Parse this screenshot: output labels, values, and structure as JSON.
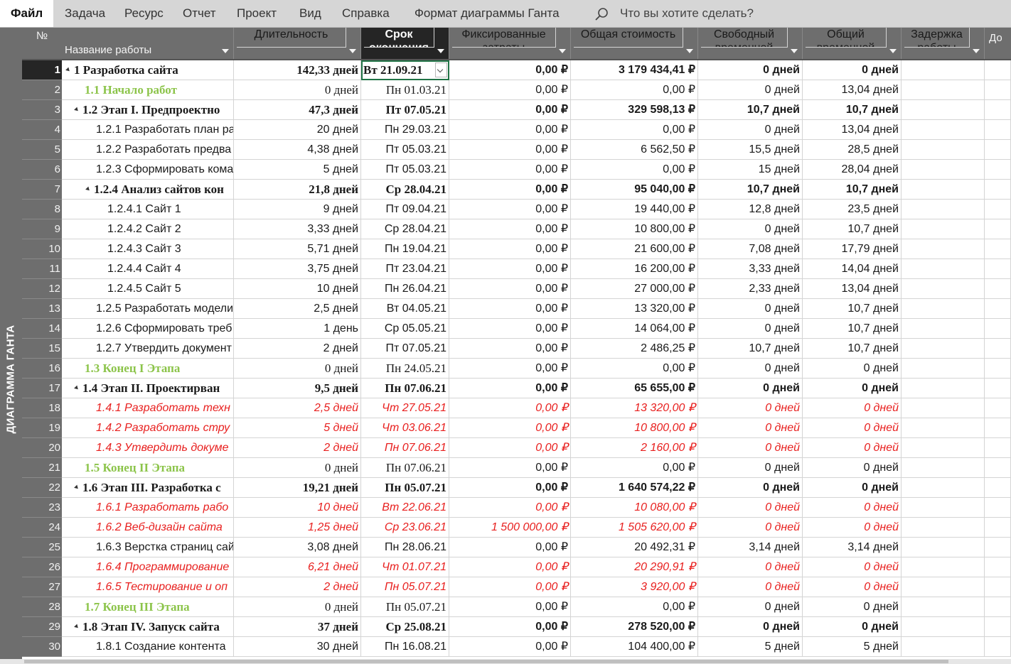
{
  "menu": {
    "file": "Файл",
    "items": [
      "Задача",
      "Ресурс",
      "Отчет",
      "Проект",
      "Вид",
      "Справка",
      "Формат диаграммы Ганта"
    ],
    "search_placeholder": "Что вы хотите сделать?"
  },
  "sidebar_label": "ДИАГРАММА ГАНТА",
  "columns": {
    "num": "№",
    "name": "Название работы",
    "duration": "Длительность",
    "finish": [
      "Срок",
      "окончания"
    ],
    "fixed_cost": [
      "Фиксированные",
      "затраты"
    ],
    "total_cost": "Общая стоимость",
    "free_slack": [
      "Свободный",
      "временной"
    ],
    "total_slack": [
      "Общий",
      "временной"
    ],
    "delay": [
      "Задержка",
      "работы"
    ],
    "next": "До"
  },
  "rows": [
    {
      "n": "1",
      "name": "1 Разработка сайта",
      "dur": "142,33 дней",
      "fin": "Вт 21.09.21",
      "fix": "0,00 ₽",
      "cost": "3 179 434,41 ₽",
      "free": "0 дней",
      "total": "0 дней",
      "type": "summary",
      "level": 0
    },
    {
      "n": "2",
      "name": "1.1 Начало работ",
      "dur": "0 дней",
      "fin": "Пн 01.03.21",
      "fix": "0,00 ₽",
      "cost": "0,00 ₽",
      "free": "0 дней",
      "total": "13,04 дней",
      "type": "milestone",
      "level": 1
    },
    {
      "n": "3",
      "name": "1.2 Этап I. Предпроектно",
      "dur": "47,3 дней",
      "fin": "Пт 07.05.21",
      "fix": "0,00 ₽",
      "cost": "329 598,13 ₽",
      "free": "10,7 дней",
      "total": "10,7 дней",
      "type": "summary",
      "level": 1
    },
    {
      "n": "4",
      "name": "1.2.1 Разработать план ра",
      "dur": "20 дней",
      "fin": "Пн 29.03.21",
      "fix": "0,00 ₽",
      "cost": "0,00 ₽",
      "free": "0 дней",
      "total": "13,04 дней",
      "type": "normal",
      "level": 2
    },
    {
      "n": "5",
      "name": "1.2.2 Разработать предва",
      "dur": "4,38 дней",
      "fin": "Пт 05.03.21",
      "fix": "0,00 ₽",
      "cost": "6 562,50 ₽",
      "free": "15,5 дней",
      "total": "28,5 дней",
      "type": "normal",
      "level": 2
    },
    {
      "n": "6",
      "name": "1.2.3 Сформировать кома",
      "dur": "5 дней",
      "fin": "Пт 05.03.21",
      "fix": "0,00 ₽",
      "cost": "0,00 ₽",
      "free": "15 дней",
      "total": "28,04 дней",
      "type": "normal",
      "level": 2
    },
    {
      "n": "7",
      "name": "1.2.4 Анализ сайтов кон",
      "dur": "21,8 дней",
      "fin": "Ср 28.04.21",
      "fix": "0,00 ₽",
      "cost": "95 040,00 ₽",
      "free": "10,7 дней",
      "total": "10,7 дней",
      "type": "summary2",
      "level": 2
    },
    {
      "n": "8",
      "name": "1.2.4.1 Сайт 1",
      "dur": "9 дней",
      "fin": "Пт 09.04.21",
      "fix": "0,00 ₽",
      "cost": "19 440,00 ₽",
      "free": "12,8 дней",
      "total": "23,5 дней",
      "type": "normal",
      "level": 3
    },
    {
      "n": "9",
      "name": "1.2.4.2 Сайт 2",
      "dur": "3,33 дней",
      "fin": "Ср 28.04.21",
      "fix": "0,00 ₽",
      "cost": "10 800,00 ₽",
      "free": "0 дней",
      "total": "10,7 дней",
      "type": "normal",
      "level": 3
    },
    {
      "n": "10",
      "name": "1.2.4.3 Сайт 3",
      "dur": "5,71 дней",
      "fin": "Пн 19.04.21",
      "fix": "0,00 ₽",
      "cost": "21 600,00 ₽",
      "free": "7,08 дней",
      "total": "17,79 дней",
      "type": "normal",
      "level": 3
    },
    {
      "n": "11",
      "name": "1.2.4.4 Сайт 4",
      "dur": "3,75 дней",
      "fin": "Пт 23.04.21",
      "fix": "0,00 ₽",
      "cost": "16 200,00 ₽",
      "free": "3,33 дней",
      "total": "14,04 дней",
      "type": "normal",
      "level": 3
    },
    {
      "n": "12",
      "name": "1.2.4.5 Сайт 5",
      "dur": "10 дней",
      "fin": "Пн 26.04.21",
      "fix": "0,00 ₽",
      "cost": "27 000,00 ₽",
      "free": "2,33 дней",
      "total": "13,04 дней",
      "type": "normal",
      "level": 3
    },
    {
      "n": "13",
      "name": "1.2.5 Разработать модели",
      "dur": "2,5 дней",
      "fin": "Вт 04.05.21",
      "fix": "0,00 ₽",
      "cost": "13 320,00 ₽",
      "free": "0 дней",
      "total": "10,7 дней",
      "type": "normal",
      "level": 2
    },
    {
      "n": "14",
      "name": "1.2.6 Сформировать треб",
      "dur": "1 день",
      "fin": "Ср 05.05.21",
      "fix": "0,00 ₽",
      "cost": "14 064,00 ₽",
      "free": "0 дней",
      "total": "10,7 дней",
      "type": "normal",
      "level": 2
    },
    {
      "n": "15",
      "name": "1.2.7 Утвердить документ",
      "dur": "2 дней",
      "fin": "Пт 07.05.21",
      "fix": "0,00 ₽",
      "cost": "2 486,25 ₽",
      "free": "10,7 дней",
      "total": "10,7 дней",
      "type": "normal",
      "level": 2
    },
    {
      "n": "16",
      "name": "1.3 Конец I Этапа",
      "dur": "0 дней",
      "fin": "Пн 24.05.21",
      "fix": "0,00 ₽",
      "cost": "0,00 ₽",
      "free": "0 дней",
      "total": "0 дней",
      "type": "milestone",
      "level": 1
    },
    {
      "n": "17",
      "name": "1.4 Этап II. Проектирван",
      "dur": "9,5 дней",
      "fin": "Пн 07.06.21",
      "fix": "0,00 ₽",
      "cost": "65 655,00 ₽",
      "free": "0 дней",
      "total": "0 дней",
      "type": "summary",
      "level": 1
    },
    {
      "n": "18",
      "name": "1.4.1 Разработать техн",
      "dur": "2,5 дней",
      "fin": "Чт 27.05.21",
      "fix": "0,00 ₽",
      "cost": "13 320,00 ₽",
      "free": "0 дней",
      "total": "0 дней",
      "type": "critical",
      "level": 2
    },
    {
      "n": "19",
      "name": "1.4.2 Разработать стру",
      "dur": "5 дней",
      "fin": "Чт 03.06.21",
      "fix": "0,00 ₽",
      "cost": "10 800,00 ₽",
      "free": "0 дней",
      "total": "0 дней",
      "type": "critical",
      "level": 2
    },
    {
      "n": "20",
      "name": "1.4.3 Утвердить докуме",
      "dur": "2 дней",
      "fin": "Пн 07.06.21",
      "fix": "0,00 ₽",
      "cost": "2 160,00 ₽",
      "free": "0 дней",
      "total": "0 дней",
      "type": "critical",
      "level": 2
    },
    {
      "n": "21",
      "name": "1.5 Конец II Этапа",
      "dur": "0 дней",
      "fin": "Пн 07.06.21",
      "fix": "0,00 ₽",
      "cost": "0,00 ₽",
      "free": "0 дней",
      "total": "0 дней",
      "type": "milestone",
      "level": 1
    },
    {
      "n": "22",
      "name": "1.6 Этап III. Разработка с",
      "dur": "19,21 дней",
      "fin": "Пн 05.07.21",
      "fix": "0,00 ₽",
      "cost": "1 640 574,22 ₽",
      "free": "0 дней",
      "total": "0 дней",
      "type": "summary",
      "level": 1
    },
    {
      "n": "23",
      "name": "1.6.1 Разработать рабо",
      "dur": "10 дней",
      "fin": "Вт 22.06.21",
      "fix": "0,00 ₽",
      "cost": "10 080,00 ₽",
      "free": "0 дней",
      "total": "0 дней",
      "type": "critical",
      "level": 2
    },
    {
      "n": "24",
      "name": "1.6.2 Веб-дизайн сайта",
      "dur": "1,25 дней",
      "fin": "Ср 23.06.21",
      "fix": "1 500 000,00 ₽",
      "cost": "1 505 620,00 ₽",
      "free": "0 дней",
      "total": "0 дней",
      "type": "critical",
      "level": 2
    },
    {
      "n": "25",
      "name": "1.6.3 Верстка страниц сай",
      "dur": "3,08 дней",
      "fin": "Пн 28.06.21",
      "fix": "0,00 ₽",
      "cost": "20 492,31 ₽",
      "free": "3,14 дней",
      "total": "3,14 дней",
      "type": "normal",
      "level": 2
    },
    {
      "n": "26",
      "name": "1.6.4 Программирование",
      "dur": "6,21 дней",
      "fin": "Чт 01.07.21",
      "fix": "0,00 ₽",
      "cost": "20 290,91 ₽",
      "free": "0 дней",
      "total": "0 дней",
      "type": "critical",
      "level": 2
    },
    {
      "n": "27",
      "name": "1.6.5 Тестирование и оп",
      "dur": "2 дней",
      "fin": "Пн 05.07.21",
      "fix": "0,00 ₽",
      "cost": "3 920,00 ₽",
      "free": "0 дней",
      "total": "0 дней",
      "type": "critical",
      "level": 2
    },
    {
      "n": "28",
      "name": "1.7 Конец III Этапа",
      "dur": "0 дней",
      "fin": "Пн 05.07.21",
      "fix": "0,00 ₽",
      "cost": "0,00 ₽",
      "free": "0 дней",
      "total": "0 дней",
      "type": "milestone",
      "level": 1
    },
    {
      "n": "29",
      "name": "1.8 Этап IV. Запуск сайта",
      "dur": "37 дней",
      "fin": "Ср 25.08.21",
      "fix": "0,00 ₽",
      "cost": "278 520,00 ₽",
      "free": "0 дней",
      "total": "0 дней",
      "type": "summary",
      "level": 1
    },
    {
      "n": "30",
      "name": "1.8.1 Создание контента",
      "dur": "30 дней",
      "fin": "Пн 16.08.21",
      "fix": "0,00 ₽",
      "cost": "104 400,00 ₽",
      "free": "5 дней",
      "total": "5 дней",
      "type": "normal",
      "level": 2
    }
  ],
  "colors": {
    "milestone": "#8cc44a",
    "critical": "#e8201f",
    "header_bg": "#6e6e6e",
    "selected_header": "#252525"
  }
}
